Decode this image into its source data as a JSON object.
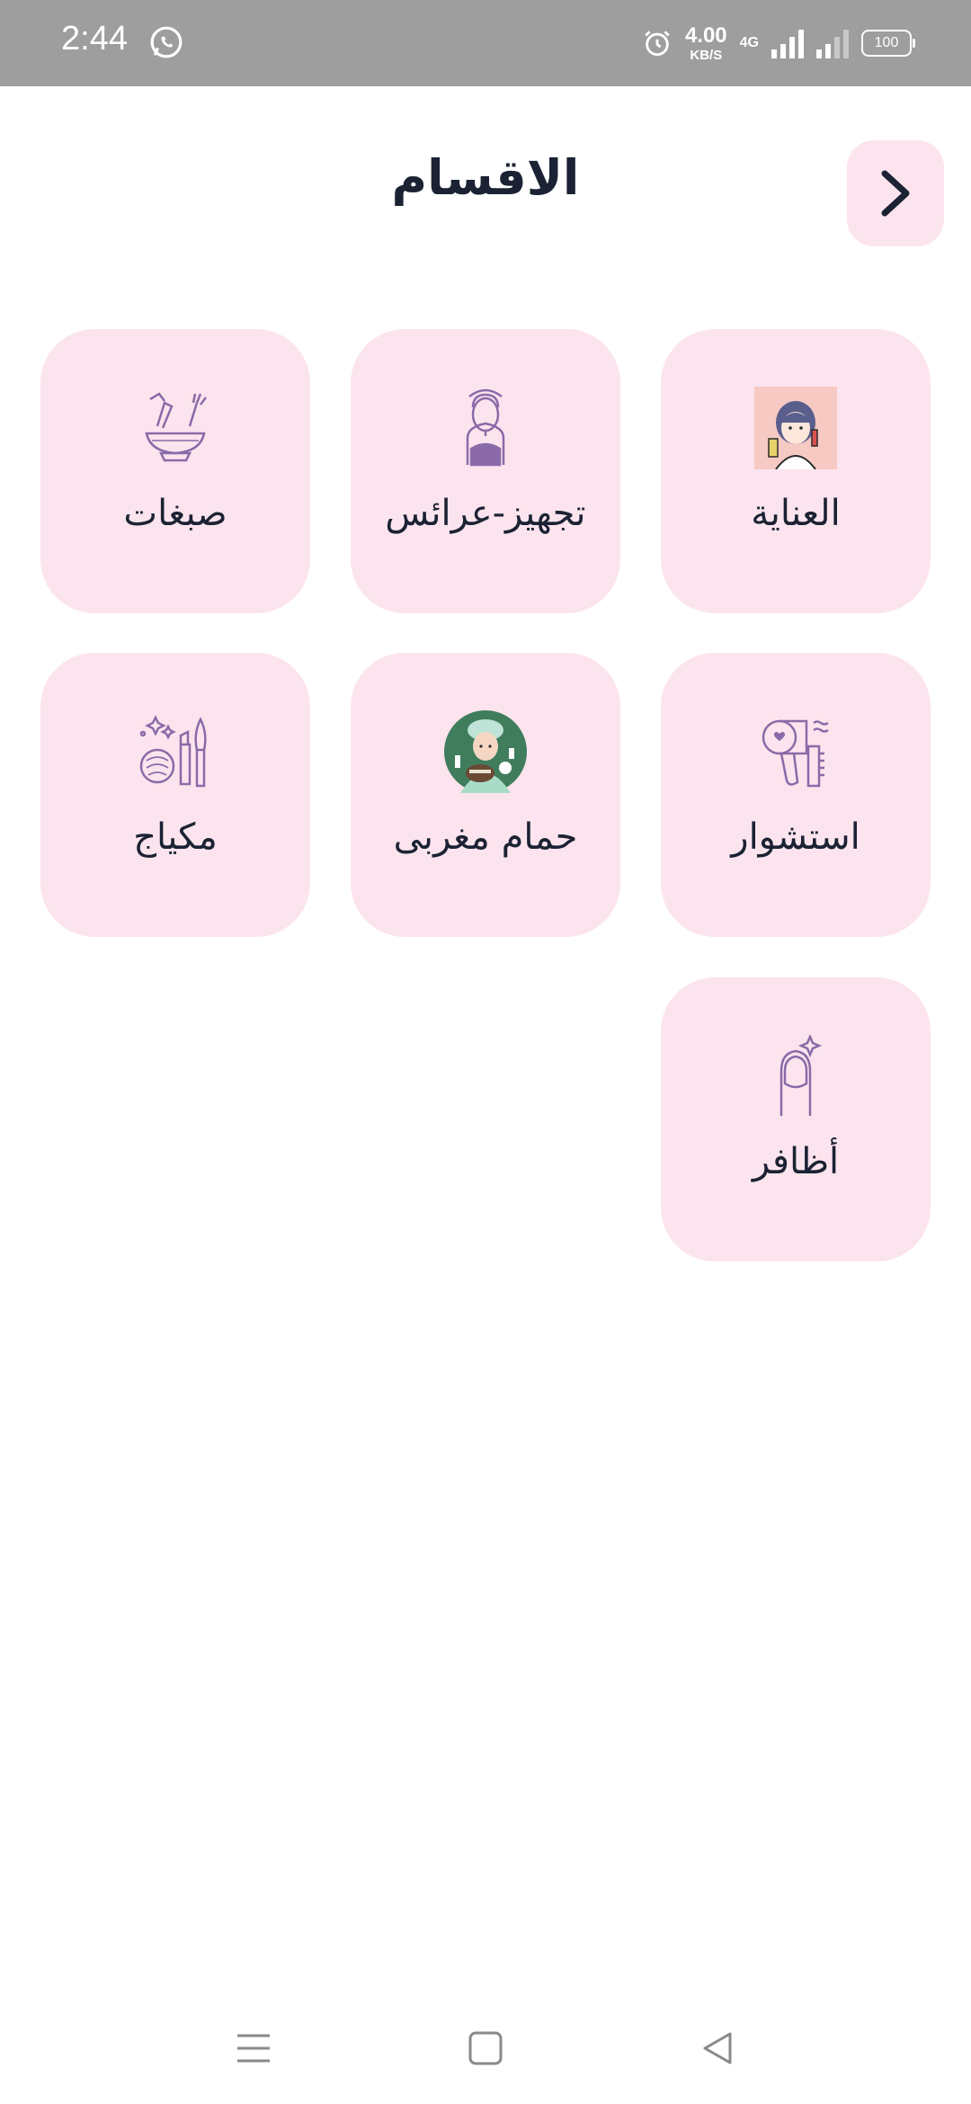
{
  "status_bar": {
    "time": "2:44",
    "speed_value": "4.00",
    "speed_unit": "KB/S",
    "network": "4G",
    "battery": "100"
  },
  "header": {
    "title": "الاقسام"
  },
  "categories": [
    {
      "label": "العناية",
      "icon": "skincare-woman-icon"
    },
    {
      "label": "تجهيز-عرائس",
      "icon": "bride-icon"
    },
    {
      "label": "صبغات",
      "icon": "hair-dye-bowl-icon"
    },
    {
      "label": "استشوار",
      "icon": "hair-dryer-icon"
    },
    {
      "label": "حمام مغربى",
      "icon": "moroccan-bath-icon"
    },
    {
      "label": "مكياج",
      "icon": "makeup-icon"
    },
    {
      "label": "أظافر",
      "icon": "nail-icon"
    }
  ],
  "colors": {
    "card_background": "#fce4ee",
    "title_text": "#1b2233",
    "icon_stroke": "#8a6aa8",
    "status_bar": "#9e9e9e"
  }
}
